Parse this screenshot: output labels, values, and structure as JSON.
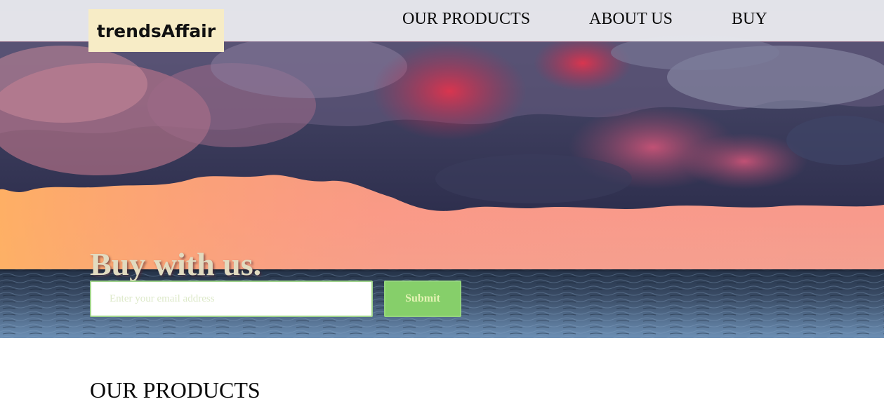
{
  "header": {
    "logo_text": "trendsAffair",
    "nav": [
      {
        "label": "OUR PRODUCTS"
      },
      {
        "label": "ABOUT US"
      },
      {
        "label": "BUY"
      }
    ]
  },
  "hero": {
    "title": "Buy with us.",
    "email_placeholder": "Enter your email address",
    "submit_label": "Submit",
    "background": "sunset sky with storm clouds over the sea"
  },
  "products": {
    "heading": "OUR PRODUCTS"
  },
  "colors": {
    "header_bg": "#e6e7ec",
    "logo_bg": "#f7ecc6",
    "title_text": "#e2dbc0",
    "button_bg": "#86cf6a",
    "button_text": "#e4f3b4",
    "input_border": "#9ed28a"
  }
}
